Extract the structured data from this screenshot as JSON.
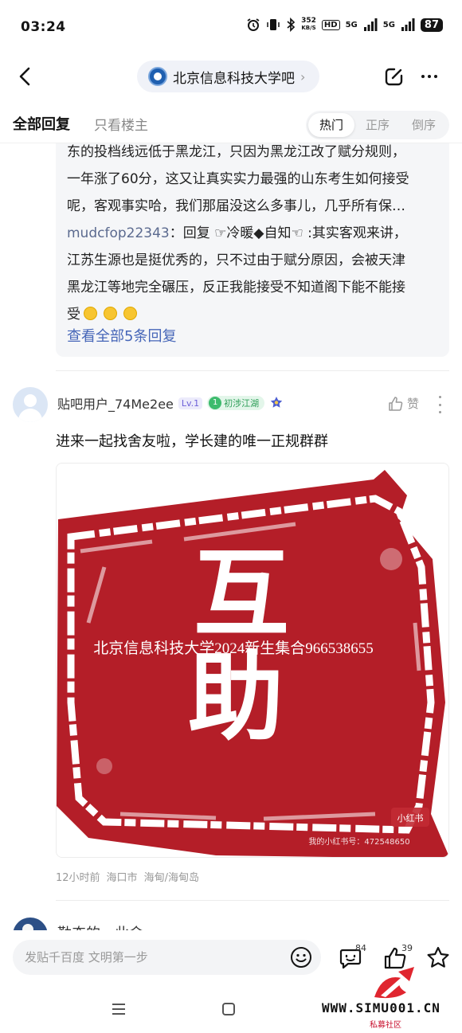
{
  "status_bar": {
    "time": "03:24",
    "net_speed": "352",
    "net_unit": "KB/S",
    "hd": "HD",
    "sim1": "5G",
    "sim2": "5G",
    "battery": "87"
  },
  "nav": {
    "forum_name": "北京信息科技大学吧",
    "forum_chevron": "›"
  },
  "filter": {
    "tab_all": "全部回复",
    "tab_op_only": "只看楼主",
    "sort_hot": "热门",
    "sort_asc": "正序",
    "sort_desc": "倒序"
  },
  "subreply": {
    "line1": "东的投档线远低于黑龙江，只因为黑龙江改了赋分规则，",
    "line2": "一年涨了60分，这又让真实实力最强的山东考生如何接受",
    "line3": "呢，客观事实哈，我们那届没这么多事儿，几乎所有保…",
    "reply_user": "mudcfop22343",
    "reply_prefix": "：回复 ☞冷暖◆自知☜ :其实客观来讲，",
    "line5": "江苏生源也是挺优秀的，只不过由于赋分原因，会被天津",
    "line6": "黑龙江等地完全碾压，反正我能接受不知道阁下能不能接",
    "line7": "受",
    "view_all": "查看全部5条回复"
  },
  "post": {
    "username": "贴吧用户_74Me2ee",
    "level": "Lv.1",
    "rank_num": "1",
    "rank_title": "初涉江湖",
    "like_label": "赞",
    "text": "进来一起找舍友啦，学长建的唯一正规群群",
    "image_big_char1": "互",
    "image_big_char2": "助",
    "image_caption": "北京信息科技大学2024新生集合966538655",
    "image_small_logo": "小红书",
    "image_small_id": "我的小红书号：472548650",
    "time": "12小时前",
    "location1": "海口市",
    "location2": "海甸/海甸岛"
  },
  "next_post": {
    "username": "勤奋的一此金"
  },
  "bottom": {
    "reply_placeholder": "发贴千百度 文明第一步",
    "comment_count": "84",
    "like_count": "39"
  },
  "watermark": {
    "text": "WWW.SIMU001.CN",
    "sub": "私募社区"
  },
  "colors": {
    "accent_link": "#4666b8",
    "stamp_red": "#b41e28",
    "level_purple": "#6c5fd8",
    "rank_green": "#3dbb6d"
  }
}
